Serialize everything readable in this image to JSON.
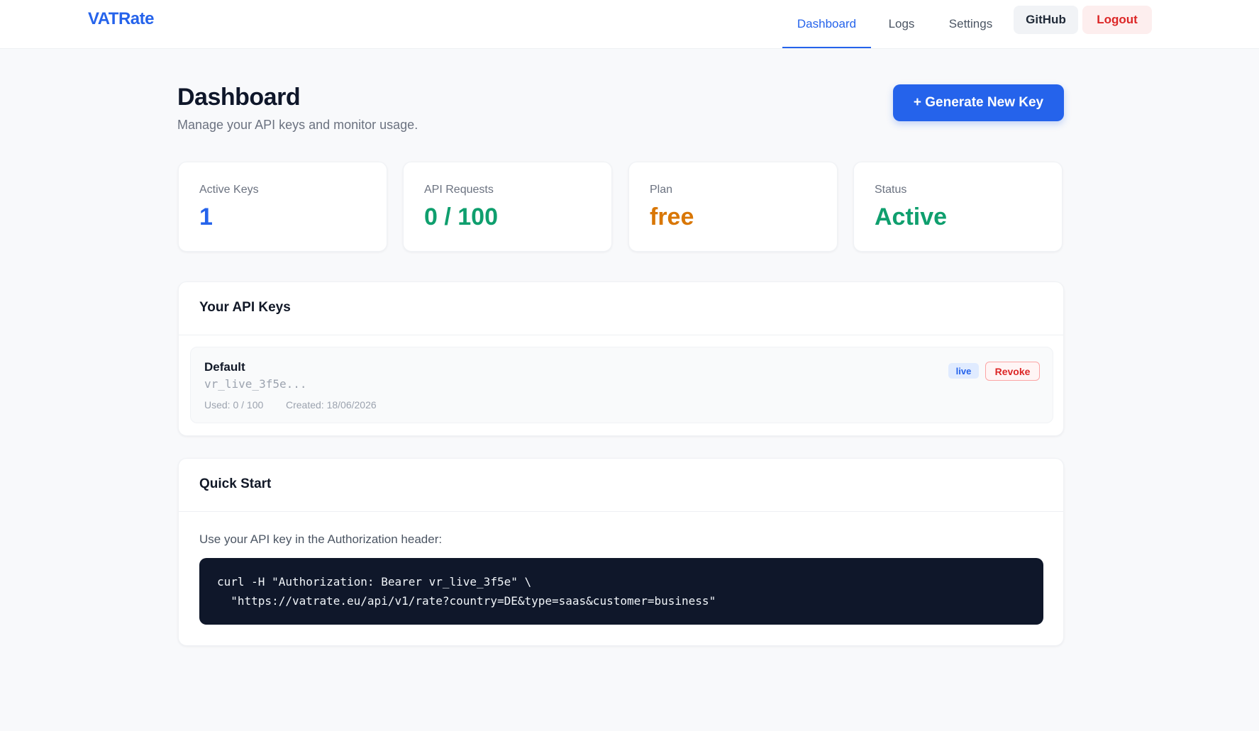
{
  "nav": {
    "brand": "VATRate",
    "links": [
      {
        "label": "Dashboard",
        "active": true
      },
      {
        "label": "Logs",
        "active": false
      },
      {
        "label": "Settings",
        "active": false
      }
    ],
    "github_label": "GitHub",
    "logout_label": "Logout"
  },
  "header": {
    "title": "Dashboard",
    "subtitle": "Manage your API keys and monitor usage.",
    "generate_button": "+ Generate New Key"
  },
  "stats": [
    {
      "label": "Active Keys",
      "value": "1",
      "color": "#2563eb"
    },
    {
      "label": "API Requests",
      "value": "0 / 100",
      "color": "#0f9f6e"
    },
    {
      "label": "Plan",
      "value": "free",
      "color": "#d97706"
    },
    {
      "label": "Status",
      "value": "Active",
      "color": "#0f9f6e"
    }
  ],
  "api_keys": {
    "title": "Your API Keys",
    "keys": [
      {
        "name": "Default",
        "prefix": "vr_live_3f5e...",
        "used": "Used: 0 / 100",
        "created": "Created: 18/06/2026",
        "badge": "live",
        "revoke_label": "Revoke"
      }
    ]
  },
  "quick_start": {
    "title": "Quick Start",
    "description": "Use your API key in the Authorization header:",
    "code": "curl -H \"Authorization: Bearer vr_live_3f5e\" \\\n  \"https://vatrate.eu/api/v1/rate?country=DE&type=saas&customer=business\""
  },
  "colors": {
    "accent": "#2563eb",
    "danger": "#dc2626",
    "success": "#0f9f6e",
    "warning": "#d97706",
    "code_bg": "#0f172a"
  }
}
